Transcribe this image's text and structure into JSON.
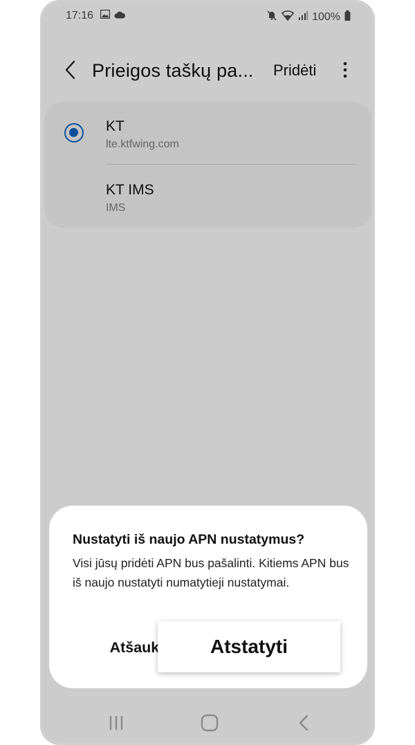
{
  "status_bar": {
    "time": "17:16",
    "battery": "100%",
    "icons": [
      "gallery-icon",
      "cloud-icon",
      "mute-icon",
      "wifi-icon",
      "signal-icon",
      "battery-icon"
    ]
  },
  "app_bar": {
    "title": "Prieigos taškų pa...",
    "add_label": "Pridėti",
    "icons": [
      "back-arrow-icon",
      "more-vert-icon"
    ]
  },
  "apn_list": [
    {
      "name": "KT",
      "apn": "lte.ktfwing.com",
      "selected": true
    },
    {
      "name": "KT IMS",
      "apn": "IMS",
      "selected": false
    }
  ],
  "dialog": {
    "title": "Nustatyti iš naujo APN nustatymus?",
    "body": "Visi jūsų pridėti APN bus pašalinti. Kitiems APN bus iš naujo nustatyti numatytieji nustatymai.",
    "cancel_label": "Atšaukti",
    "confirm_label": "Atstatyti"
  },
  "nav_bar": {
    "icons": [
      "recent-apps-icon",
      "home-icon",
      "back-nav-icon"
    ]
  },
  "colors": {
    "accent": "#1565c0",
    "scrim": "#000000"
  }
}
